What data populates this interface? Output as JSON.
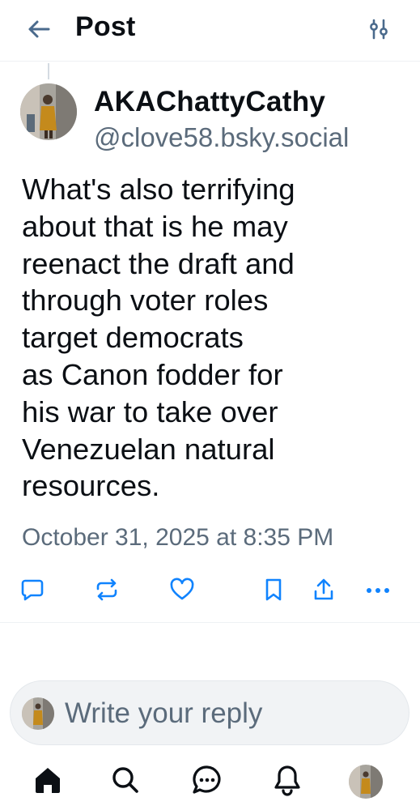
{
  "header": {
    "title": "Post",
    "back_icon": "arrow-left-icon",
    "filter_icon": "sliders-icon"
  },
  "post": {
    "author": {
      "display_name": "AKAChattyCathy",
      "handle": "@clove58.bsky.social"
    },
    "text": "What's also terrifying\nabout that is he may\nreenact the draft and\nthrough voter roles\ntarget democrats\nas Canon fodder for\nhis war to take over\nVenezuelan natural\nresources.",
    "timestamp": "October 31, 2025 at 8:35 PM"
  },
  "actions": [
    "reply-icon",
    "repost-icon",
    "like-icon",
    "bookmark-icon",
    "share-icon",
    "more-icon"
  ],
  "reply_box": {
    "placeholder": "Write your reply"
  },
  "bottom_nav": [
    "home-icon",
    "search-icon",
    "chat-icon",
    "notifications-icon",
    "profile-avatar"
  ],
  "colors": {
    "text": "#0b0f14",
    "muted": "#5b6b7b",
    "icon": "#1083fe",
    "divider": "#eef1f4"
  }
}
